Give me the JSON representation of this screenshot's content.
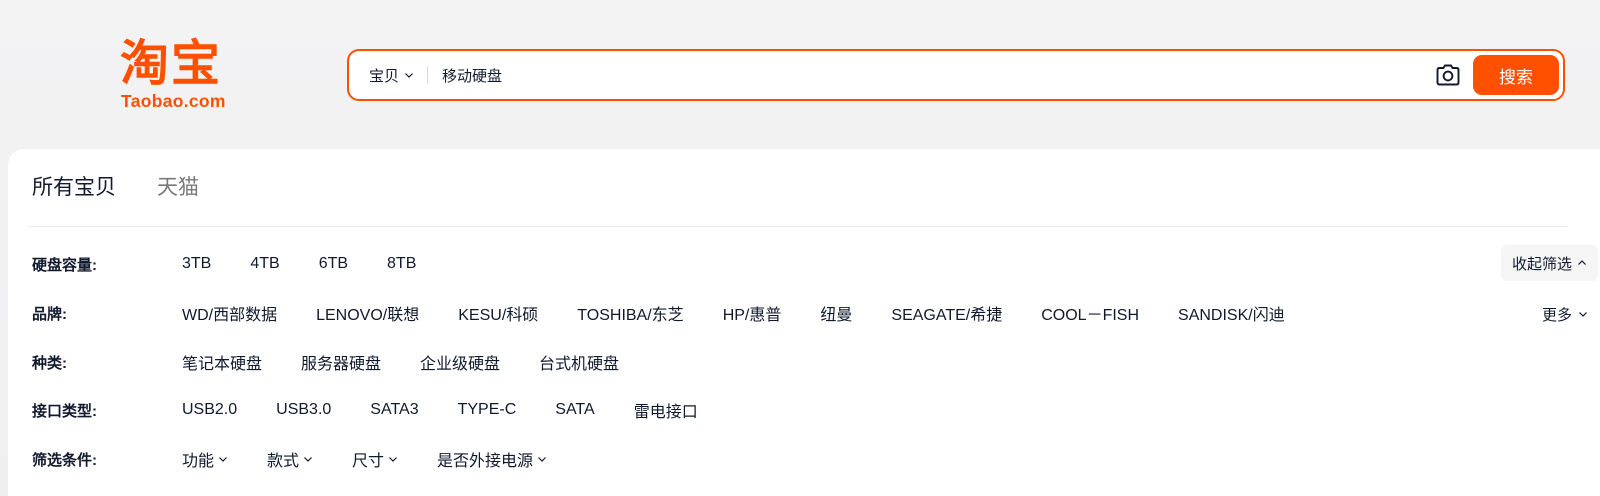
{
  "logo": {
    "chinese": "淘宝",
    "domain": "Taobao.com"
  },
  "search": {
    "scope_label": "宝贝",
    "query": "移动硬盘",
    "camera_icon": "camera-icon",
    "button_label": "搜索"
  },
  "tabs": [
    {
      "label": "所有宝贝",
      "active": true
    },
    {
      "label": "天猫",
      "active": false
    }
  ],
  "filters": {
    "collapse_label": "收起筛选",
    "more_label": "更多",
    "rows": [
      {
        "label": "硬盘容量:",
        "options": [
          "3TB",
          "4TB",
          "6TB",
          "8TB"
        ]
      },
      {
        "label": "品牌:",
        "options": [
          "WD/西部数据",
          "LENOVO/联想",
          "KESU/科硕",
          "TOSHIBA/东芝",
          "HP/惠普",
          "纽曼",
          "SEAGATE/希捷",
          "COOL－FISH",
          "SANDISK/闪迪"
        ]
      },
      {
        "label": "种类:",
        "options": [
          "笔记本硬盘",
          "服务器硬盘",
          "企业级硬盘",
          "台式机硬盘"
        ]
      },
      {
        "label": "接口类型:",
        "options": [
          "USB2.0",
          "USB3.0",
          "SATA3",
          "TYPE-C",
          "SATA",
          "雷电接口"
        ]
      },
      {
        "label": "筛选条件:",
        "options": [
          "功能",
          "款式",
          "尺寸",
          "是否外接电源"
        ]
      }
    ]
  },
  "colors": {
    "accent": "#ff5000",
    "text": "#11192d",
    "muted": "#7a7a7a"
  }
}
